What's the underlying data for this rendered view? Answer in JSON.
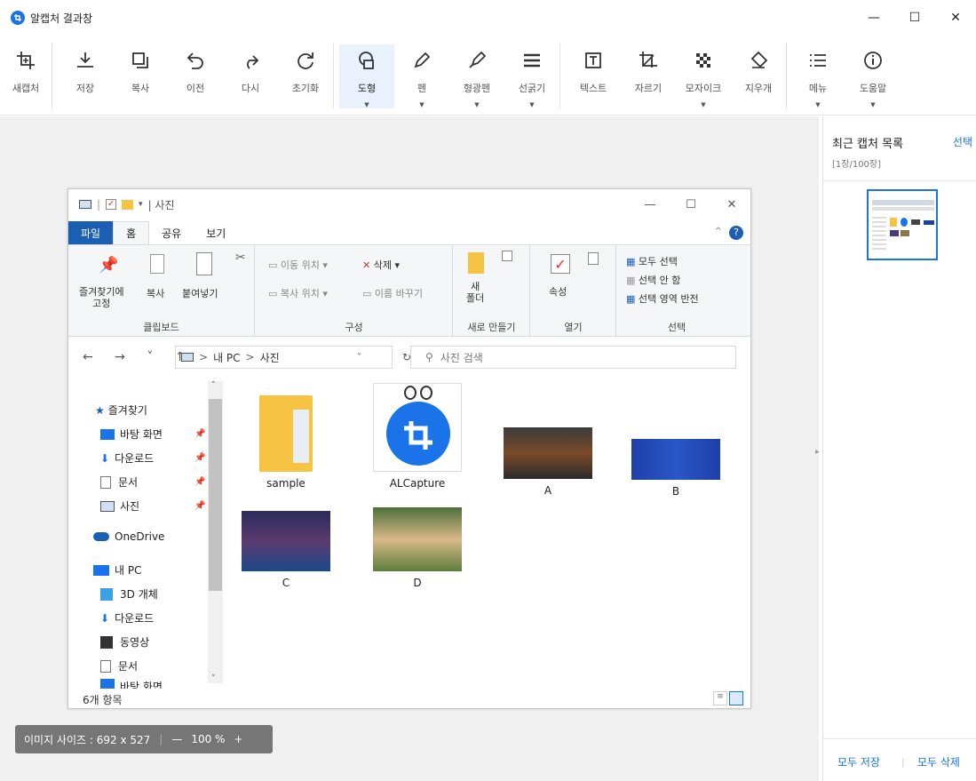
{
  "app": {
    "title": "알캡처 결과창",
    "win_min": "—",
    "win_max": "☐",
    "win_close": "✕"
  },
  "toolbar": {
    "new_capture": "새캡처",
    "save": "저장",
    "copy": "복사",
    "undo": "이전",
    "redo": "다시",
    "reset": "초기화",
    "shape": "도형",
    "pen": "펜",
    "highlighter": "형광펜",
    "line_width": "선굵기",
    "text": "텍스트",
    "crop": "자르기",
    "mosaic": "모자이크",
    "eraser": "지우개",
    "menu": "메뉴",
    "help": "도움말",
    "active_tool": "도형",
    "accent_color": "#1a73e8"
  },
  "right_panel": {
    "header": "최근 캡처 목록",
    "select": "선택",
    "count": "[1장/100장]",
    "save_all": "모두 저장",
    "separator": "|",
    "delete_all": "모두 삭제"
  },
  "sizebar": {
    "image_size": "이미지 사이즈 : 692 x 527",
    "separator": "|",
    "zoom_out": "—",
    "zoom": "100 %",
    "zoom_in": "+"
  },
  "explorer": {
    "title": "| 사진",
    "tabs": [
      "파일",
      "홈",
      "공유",
      "보기"
    ],
    "ribbon": {
      "pin": "즐겨찾기에\n고정",
      "copy": "복사",
      "paste": "붙여넣기",
      "clipboard": "클립보드",
      "move_to": "이동 위치",
      "copy_to": "복사 위치",
      "delete": "삭제",
      "rename": "이름 바꾸기",
      "organize": "구성",
      "new_folder": "새\n폴더",
      "new": "새로 만들기",
      "properties": "속성",
      "open": "열기",
      "select_all": "모두 선택",
      "select_none": "선택 안 함",
      "invert": "선택 영역 반전",
      "select": "선택"
    },
    "address": {
      "path_pc": "내 PC",
      "path_sep": ">",
      "path_folder": "사진",
      "search_placeholder": "사진 검색"
    },
    "nav": {
      "favorites": "즐겨찾기",
      "desktop": "바탕 화면",
      "downloads": "다운로드",
      "documents": "문서",
      "pictures": "사진",
      "onedrive": "OneDrive",
      "this_pc": "내 PC",
      "objects3d": "3D 개체",
      "downloads2": "다운로드",
      "videos": "동영상",
      "documents2": "문서",
      "desktop2": "바탕 화면"
    },
    "files": [
      {
        "name": "sample"
      },
      {
        "name": "ALCapture"
      },
      {
        "name": "A"
      },
      {
        "name": "B"
      },
      {
        "name": "C"
      },
      {
        "name": "D"
      }
    ],
    "status": "6개 항목"
  }
}
